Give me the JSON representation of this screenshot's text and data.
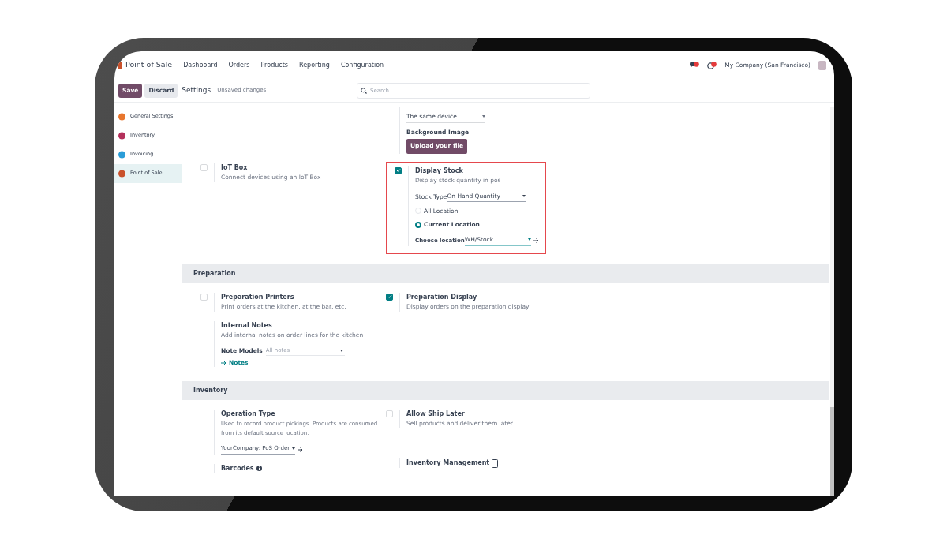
{
  "navbar": {
    "app": "Point of Sale",
    "menu": [
      "Dashboard",
      "Orders",
      "Products",
      "Reporting",
      "Configuration"
    ],
    "company": "My Company (San Francisco)"
  },
  "control_bar": {
    "buttons": [
      {
        "label": "Save",
        "kind": "primary"
      },
      {
        "label": "Discard",
        "kind": "secondary"
      }
    ],
    "title": "Settings",
    "status": "Unsaved changes",
    "search": {
      "placeholder": "Search..."
    }
  },
  "sidebar": {
    "items": [
      {
        "label": "General Settings",
        "selected": false,
        "color": "#e8762d"
      },
      {
        "label": "Inventory",
        "selected": false,
        "color": "#b4305b"
      },
      {
        "label": "Invoicing",
        "selected": false,
        "color": "#2a9dd8"
      },
      {
        "label": "Point of Sale",
        "selected": true,
        "color": "#c9512b"
      }
    ]
  },
  "top": {
    "device_select": "The same device",
    "background_label": "Background Image",
    "upload_button": "Upload your file",
    "iot": {
      "title": "IoT Box",
      "description": "Connect devices using an IoT Box",
      "checked": false
    },
    "display_stock": {
      "title": "Display Stock",
      "description": "Display stock quantity in pos",
      "checked": true,
      "highlighted": true,
      "stock_type_label": "Stock Type",
      "stock_type_value": "On Hand Quantity",
      "radios": [
        {
          "label": "All Location",
          "selected": false
        },
        {
          "label": "Current Location",
          "selected": true
        }
      ],
      "location_label": "Choose location",
      "location_value": "WH/Stock"
    }
  },
  "preparation": {
    "title": "Preparation",
    "printers": {
      "title": "Preparation Printers",
      "description": "Print orders at the kitchen, at the bar, etc.",
      "checked": false
    },
    "display": {
      "title": "Preparation Display",
      "description": "Display orders on the preparation display",
      "checked": true
    },
    "notes": {
      "title": "Internal Notes",
      "description": "Add internal notes on order lines for the kitchen",
      "field_label": "Note Models",
      "placeholder": "All notes",
      "link": "Notes"
    }
  },
  "inventory": {
    "title": "Inventory",
    "operation": {
      "title": "Operation Type",
      "description": "Used to record product pickings. Products are consumed from its default source location.",
      "value": "YourCompany: PoS Order"
    },
    "ship_later": {
      "title": "Allow Ship Later",
      "description": "Sell products and deliver them later.",
      "checked": false
    },
    "barcodes": {
      "title": "Barcodes"
    },
    "management": {
      "title": "Inventory Management"
    }
  }
}
